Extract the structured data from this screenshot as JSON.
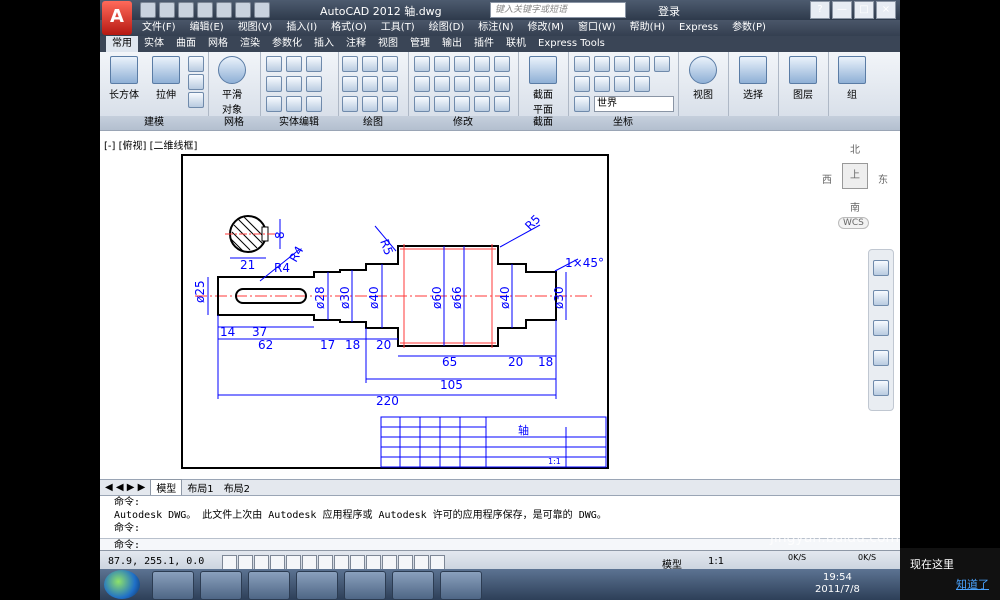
{
  "titlebar": {
    "app_letter": "A",
    "title": "AutoCAD 2012   轴.dwg",
    "search_placeholder": "键入关键字或短语",
    "login": "登录",
    "buttons": [
      "?",
      "—",
      "□",
      "×"
    ]
  },
  "menubar": [
    "文件(F)",
    "编辑(E)",
    "视图(V)",
    "插入(I)",
    "格式(O)",
    "工具(T)",
    "绘图(D)",
    "标注(N)",
    "修改(M)",
    "窗口(W)",
    "帮助(H)",
    "Express",
    "参数(P)"
  ],
  "ribbon_tabs": [
    "常用",
    "实体",
    "曲面",
    "网格",
    "渲染",
    "参数化",
    "插入",
    "注释",
    "视图",
    "管理",
    "输出",
    "插件",
    "联机",
    "Express Tools"
  ],
  "ribbon_tabs_active": "网格",
  "ribbon": {
    "panel_labels": [
      "建模",
      "网格",
      "实体编辑",
      "绘图",
      "修改",
      "截面",
      "坐标",
      "",
      "",
      "",
      ""
    ],
    "big_buttons": {
      "box": "长方体",
      "extrude": "拉伸",
      "smooth": "平滑\n对象",
      "section": "截面\n平面",
      "view": "视图",
      "select": "选择",
      "layers": "图层",
      "group": "组"
    },
    "ucs_combo": "世界"
  },
  "viewport": {
    "label": "[-] [俯视] [二维线框]",
    "viewcube": {
      "north": "北",
      "south": "南",
      "east": "东",
      "west": "西",
      "top": "上",
      "wcs": "WCS"
    }
  },
  "drawing": {
    "dims": {
      "d25": "ø25",
      "d28": "ø28",
      "d30a": "ø30",
      "d40a": "ø40",
      "d60": "ø60",
      "d66": "ø66",
      "d40b": "ø40",
      "d30b": "ø30",
      "l14": "14",
      "l37": "37",
      "l62": "62",
      "l17": "17",
      "l18a": "18",
      "l20a": "20",
      "l65": "65",
      "l20b": "20",
      "l18b": "18",
      "l105": "105",
      "l220": "220",
      "r4a": "R4",
      "r4b": "R4",
      "r5a": "R5",
      "r5b": "R5",
      "chamfer": "1×45°",
      "key8": "8",
      "key21": "21"
    },
    "titleblock": {
      "name": "轴",
      "scale": "1:1"
    }
  },
  "layout_tabs": [
    "模型",
    "布局1",
    "布局2"
  ],
  "command": {
    "line1": "命令:",
    "line2": "Autodesk DWG。  此文件上次由 Autodesk 应用程序或 Autodesk 许可的应用程序保存，是可靠的 DWG。",
    "line3": "命令:",
    "prompt": "命令:"
  },
  "status": {
    "coords": "87.9,  255.1,  0.0",
    "model": "模型",
    "scale": "1:1",
    "speed1": "0K/S",
    "speed2": "0K/S"
  },
  "taskbar": {
    "time": "19:54",
    "date": "2011/7/8"
  },
  "overlay": {
    "watermark": "Bai经验",
    "watermark_url": "jingyan.baidu.com",
    "notice": "现在这里",
    "notice_link": "知道了"
  }
}
